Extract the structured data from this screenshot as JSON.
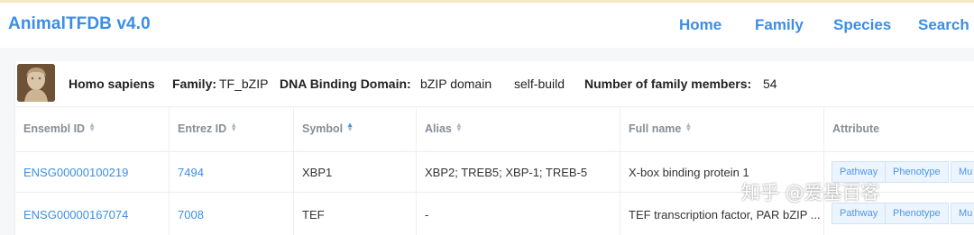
{
  "brand": "AnimalTFDB v4.0",
  "nav": {
    "home": "Home",
    "family": "Family",
    "species": "Species",
    "search": "Search"
  },
  "info": {
    "species": "Homo sapiens",
    "family_label": "Family:",
    "family_value": "TF_bZIP",
    "dbd_label": "DNA Binding Domain:",
    "dbd_value": "bZIP domain",
    "source": "self-build",
    "members_label": "Number of family members:",
    "members_value": "54"
  },
  "table": {
    "columns": [
      "Ensembl ID",
      "Entrez ID",
      "Symbol",
      "Alias",
      "Full name",
      "Attribute"
    ],
    "rows": [
      {
        "ensembl": "ENSG00000100219",
        "entrez": "7494",
        "symbol": "XBP1",
        "alias": "XBP2; TREB5; XBP-1; TREB-5",
        "fullname": "X-box binding protein 1",
        "tags": [
          "Pathway",
          "Phenotype",
          "Mu"
        ]
      },
      {
        "ensembl": "ENSG00000167074",
        "entrez": "7008",
        "symbol": "TEF",
        "alias": "-",
        "fullname": "TEF transcription factor, PAR bZIP ...",
        "tags": [
          "Pathway",
          "Phenotype",
          "Mu"
        ]
      }
    ]
  },
  "watermark": "知乎 @爱基百客"
}
